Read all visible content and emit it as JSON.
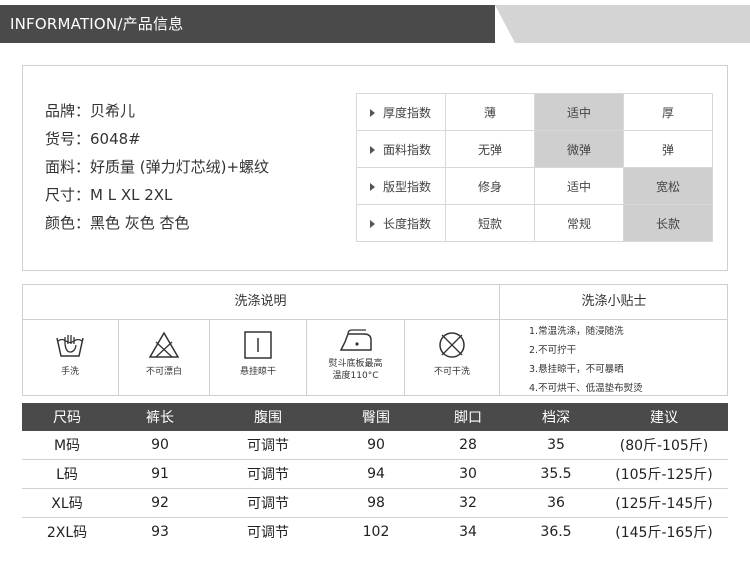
{
  "header": {
    "title": "INFORMATION/产品信息"
  },
  "info": [
    "品牌：贝希儿",
    "货号：6048#",
    "面料：好质量 (弹力灯芯绒)+螺纹",
    "尺寸：M L XL 2XL",
    "颜色：黑色 灰色  杏色"
  ],
  "indices": [
    {
      "label": "厚度指数",
      "options": [
        "薄",
        "适中",
        "厚"
      ],
      "selected": 1
    },
    {
      "label": "面料指数",
      "options": [
        "无弹",
        "微弹",
        "弹"
      ],
      "selected": 1
    },
    {
      "label": "版型指数",
      "options": [
        "修身",
        "适中",
        "宽松"
      ],
      "selected": 2
    },
    {
      "label": "长度指数",
      "options": [
        "短款",
        "常规",
        "长款"
      ],
      "selected": 2
    }
  ],
  "wash": {
    "title": "洗涤说明",
    "icons": [
      {
        "icon": "hand-wash-icon",
        "label": "手洗"
      },
      {
        "icon": "no-bleach-icon",
        "label": "不可漂白"
      },
      {
        "icon": "hang-dry-icon",
        "label": "悬挂晾干"
      },
      {
        "icon": "iron-icon",
        "label": "熨斗底板最高\n温度110°C"
      },
      {
        "icon": "no-dry-clean-icon",
        "label": "不可干洗"
      }
    ]
  },
  "tips": {
    "title": "洗涤小贴士",
    "items": [
      "1.常温洗涤，随浸随洗",
      "2.不可拧干",
      "3.悬挂晾干，不可暴晒",
      "4.不可烘干、低温垫布熨烫"
    ]
  },
  "size_table": {
    "headers": [
      "尺码",
      "裤长",
      "腹围",
      "臀围",
      "脚口",
      "档深",
      "建议"
    ],
    "rows": [
      [
        "M码",
        "90",
        "可调节",
        "90",
        "28",
        "35",
        "(80斤-105斤)"
      ],
      [
        "L码",
        "91",
        "可调节",
        "94",
        "30",
        "35.5",
        "(105斤-125斤)"
      ],
      [
        "XL码",
        "92",
        "可调节",
        "98",
        "32",
        "36",
        "(125斤-145斤)"
      ],
      [
        "2XL码",
        "93",
        "可调节",
        "102",
        "34",
        "36.5",
        "(145斤-165斤)"
      ]
    ]
  }
}
